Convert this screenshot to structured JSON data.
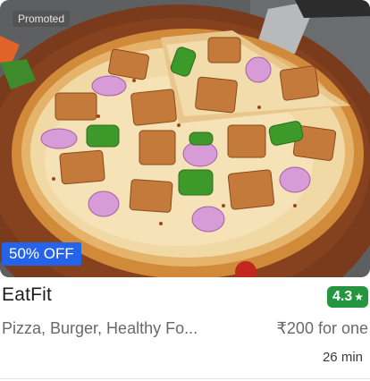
{
  "restaurant": {
    "badge_promoted": "Promoted",
    "offer_label": "50% OFF",
    "name": "EatFit",
    "rating": "4.3",
    "rating_icon": "star-icon",
    "cuisines": "Pizza, Burger, Healthy Fo...",
    "price_for_one": "₹200 for one",
    "delivery_time": "26 min",
    "image": "pizza-photo",
    "colors": {
      "offer_badge": "#2563eb",
      "rating_badge": "#24963f",
      "secondary_text": "#696969",
      "primary_text": "#1c1c1c"
    }
  }
}
